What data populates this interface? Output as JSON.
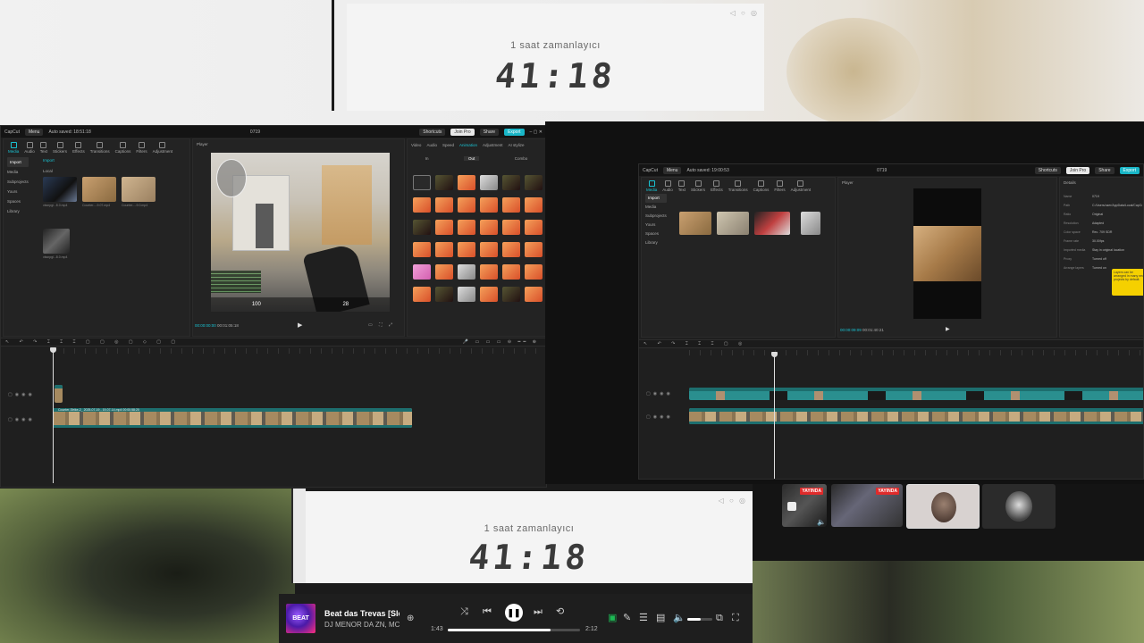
{
  "timer_top": {
    "title": "1 saat zamanlayıcı",
    "digits": "41:18"
  },
  "timer_bottom": {
    "title": "1 saat zamanlayıcı",
    "digits": "41:18"
  },
  "editor_left": {
    "titlebar": {
      "app": "CapCut",
      "menu": "Menu",
      "autosave": "Auto saved: 18:51:18",
      "project": "0719",
      "shortcuts": "Shortcuts",
      "pro": "Join Pro",
      "share": "Share",
      "export": "Export"
    },
    "toolbar": [
      "Media",
      "Audio",
      "Text",
      "Stickers",
      "Effects",
      "Transitions",
      "Captions",
      "Filters",
      "Adjustment"
    ],
    "media_tabs": {
      "import": "Import",
      "local": "Local"
    },
    "side_menu": [
      "Import",
      "Media",
      "Subprojects",
      "Yours",
      "Spaces",
      "Library"
    ],
    "media_items": [
      "vksnpgi...8.0.mp4",
      "Counter-...9.07.mp4",
      "Counter-...9.0.mp4",
      "vksnpgi...8.0.mp4"
    ],
    "player_label": "Player",
    "player_time": "00:00:00:00",
    "player_total": "00:01:05:18",
    "hud": {
      "health": "100",
      "ammo": "28"
    },
    "effects_tabs": [
      "Video",
      "Audio",
      "Speed",
      "Animation",
      "Adjustment",
      "AI stylize"
    ],
    "effects_subtabs": {
      "in": "In",
      "out": "Out",
      "combo": "Combo"
    },
    "clip_label": "Counter-Strike-2_ 2025-07-19 - 19-07-14.mp4 00:00:58:20"
  },
  "editor_right": {
    "titlebar": {
      "app": "CapCut",
      "menu": "Menu",
      "autosave": "Auto saved: 19:00:53",
      "project": "0719",
      "shortcuts": "Shortcuts",
      "pro": "Join Pro",
      "share": "Share",
      "export": "Export"
    },
    "player_label": "Player",
    "details_label": "Details",
    "details_rows": [
      {
        "k": "Name",
        "v": "0719"
      },
      {
        "k": "Path",
        "v": "C:/Users/user/AppData/Local/CapCut/User Data/Projects"
      },
      {
        "k": "Ratio",
        "v": "Original"
      },
      {
        "k": "Resolution",
        "v": "Adapted"
      },
      {
        "k": "Color space",
        "v": "Rec. 709 SDR"
      },
      {
        "k": "Frame rate",
        "v": "30.00fps"
      },
      {
        "k": "Imported media",
        "v": "Stay in original location"
      },
      {
        "k": "Proxy",
        "v": "Turned off"
      },
      {
        "k": "Arrange layers",
        "v": "Turned on"
      }
    ],
    "tooltip": "Layers can be arranged in many new projects by default.",
    "player_time": "00:00:09:09",
    "player_total": "00:01:40:21"
  },
  "tiles": {
    "live_badge_1": "YAYINDA",
    "live_badge_2": "YAYINDA"
  },
  "player": {
    "song_title": "Beat das Trevas [Slowed]",
    "artist": "DJ MENOR DA ZN, MC MT",
    "album_art_text": "BEAT",
    "elapsed": "1:43",
    "duration": "2:12",
    "progress": 0.78,
    "volume": 0.55
  },
  "colors": {
    "accent": "#19b6c7",
    "live_red": "#e02b2b",
    "spotify_green": "#1db954"
  }
}
